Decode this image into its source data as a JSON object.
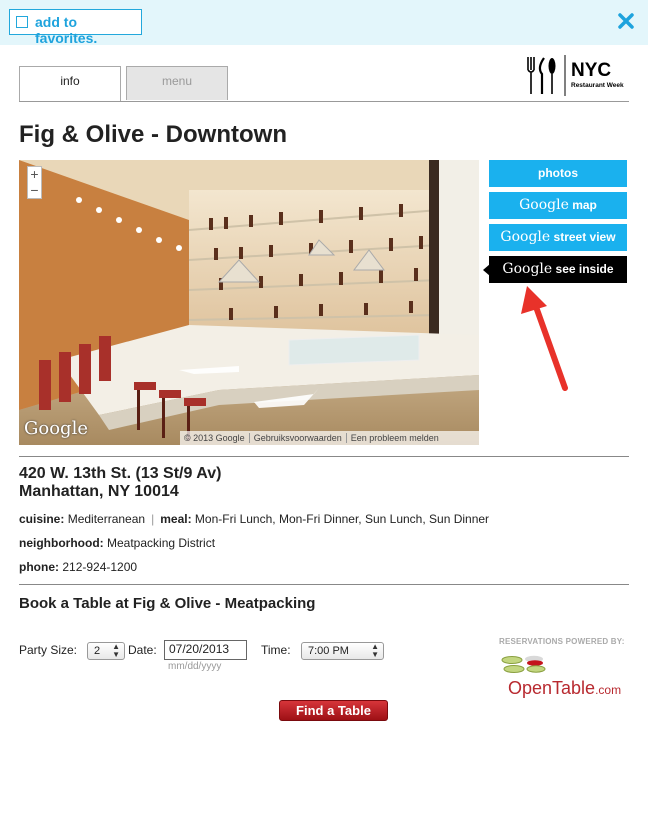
{
  "topbar": {
    "favorites_label": "add to favorites."
  },
  "tabs": [
    {
      "label": "info"
    },
    {
      "label": "menu"
    }
  ],
  "logo": {
    "text": "NYC",
    "subtext": "Restaurant Week"
  },
  "restaurant": {
    "name": "Fig & Olive - Downtown",
    "address_line1": "420 W. 13th St. (13 St/9 Av)",
    "address_line2": "Manhattan, NY 10014",
    "cuisine_label": "cuisine:",
    "cuisine": "Mediterranean",
    "meal_label": "meal:",
    "meal": "Mon-Fri Lunch, Mon-Fri Dinner, Sun Lunch, Sun Dinner",
    "neighborhood_label": "neighborhood:",
    "neighborhood": "Meatpacking District",
    "phone_label": "phone:",
    "phone": "212-924-1200"
  },
  "streetview": {
    "zoom_in": "+",
    "zoom_out": "−",
    "google_logo": "Google",
    "copyright": "© 2013 Google",
    "terms": "Gebruiksvoorwaarden",
    "report": "Een probleem melden"
  },
  "side_buttons": [
    {
      "prefix": "",
      "label": "photos",
      "active": false
    },
    {
      "prefix": "Google",
      "label": "map",
      "active": false
    },
    {
      "prefix": "Google",
      "label": "street view",
      "active": false
    },
    {
      "prefix": "Google",
      "label": "see inside",
      "active": true
    }
  ],
  "booking": {
    "title": "Book a Table at Fig & Olive - Meatpacking",
    "party_size_label": "Party Size:",
    "party_size": "2",
    "date_label": "Date:",
    "date_value": "07/20/2013",
    "date_hint": "mm/dd/yyyy",
    "time_label": "Time:",
    "time_value": "7:00 PM",
    "powered_by": "RESERVATIONS POWERED BY:",
    "opentable": "OpenTable",
    "opentable_suffix": ".com",
    "find_button": "Find a Table"
  },
  "colors": {
    "accent": "#1ab1ee",
    "topbar_bg": "#e3f6fb",
    "find_button": "#b8181e",
    "active_button": "#000000",
    "arrow": "#e8322a"
  }
}
